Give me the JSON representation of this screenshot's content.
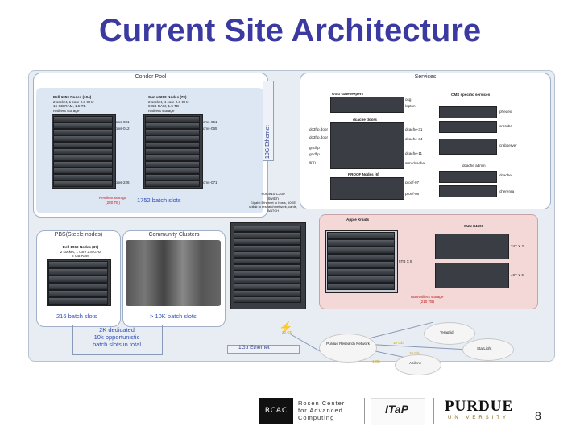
{
  "slide": {
    "title": "Current Site Architecture",
    "page_number": "8"
  },
  "condor_pool": {
    "title": "Condor Pool",
    "dell_heading": "Dell 1950 Nodes (194)",
    "dell_spec_1": "2 socket, 1 core 2.8 GHz",
    "dell_spec_2": "16 GB RAM, 1.5 TB",
    "dell_spec_3": "resilient storage",
    "sun_heading": "Sun x2200 Nodes (70)",
    "sun_spec_1": "2 socket, 4 core 2.3 GHz",
    "sun_spec_2": "8 GB RAM, 1.5 TB",
    "sun_spec_3": "resilient storage",
    "node_label_1": "cms-001",
    "node_label_2": "cms-012",
    "node_label_3": "cms-226",
    "node_label_4": "cms-051",
    "node_label_5": "cms-065",
    "node_label_6": "cms-071",
    "resilient_note": "Resilient storage",
    "resilient_size": "(280 TB)",
    "batch_slots": "1752 batch slots"
  },
  "ethernet_bar": "10G Ethernet",
  "services": {
    "title": "Services",
    "osg_gatekeepers": "OSG Gatekeepers",
    "gatekeeper_1": "osg",
    "gatekeeper_2": "lepton",
    "dcache_doors": "dcache doors",
    "door_1": "dc3ftp.door",
    "door_2": "dc3ftp.door",
    "door_3": "gridftp",
    "door_4": "gridftp",
    "door_5": "srm",
    "dcache_1": "dcache-31",
    "dcache_2": "dcache-34",
    "dcache_3": "dcache-11",
    "dcache_4": "srm-dcache",
    "cms_services": "CMS specific services",
    "cms_1": "phedex",
    "cms_2": "crossbs",
    "cms_3": "crabserver",
    "cms_4": "dcache admin",
    "cms_5": "dcache",
    "cms_6": "cherenra",
    "proof_nodes": "PROOF Nodes (6)",
    "proof_1": "proof-07",
    "proof_2": "proof-08"
  },
  "switch": {
    "name": "Force10 C300",
    "label": "Switch",
    "note": "Gigabit Ethernet to hosts, 10GE uplink to research network, cards, WATCH"
  },
  "pbs": {
    "title": "PBS(Steele nodes)",
    "heading": "Dell 1950 Nodes (37)",
    "spec_1": "2 socket, 1 core 2.8 GHz",
    "spec_2": "8 GB RAM",
    "batch_slots": "216 batch slots"
  },
  "community": {
    "title": "Community Clusters",
    "batch_slots": "> 10K batch slots"
  },
  "summary": {
    "line_1": "2K dedicated",
    "line_2": "10k opportunistic",
    "line_3": "batch slots in total"
  },
  "storage": {
    "apple_title": "Apple Xraids",
    "sun_title": "SUN X4500",
    "apple_capacity": "5TB X 8",
    "sun_capacity_1": "24T X 2",
    "sun_capacity_2": "48T X 5",
    "footer_1": "Nonresilient storage",
    "footer_2": "(210 TB)"
  },
  "network": {
    "ethernet_1g": "1Gb Ethernet",
    "link_20": "20 Gb",
    "link_10": "10 Gb",
    "link_10b": "10 Gb",
    "link_1": "1 Gb",
    "purdue_network": "Purdue Research Network",
    "teragrid": "Teragrid",
    "starlight": "StarLight",
    "abilene": "Abilene"
  },
  "logos": {
    "rcac_letters": "RCAC",
    "rcac_line_1": "Rosen Center",
    "rcac_line_2": "for Advanced",
    "rcac_line_3": "Computing",
    "itap": "ITaP",
    "purdue": "PURDUE",
    "purdue_sub": "UNIVERSITY"
  }
}
